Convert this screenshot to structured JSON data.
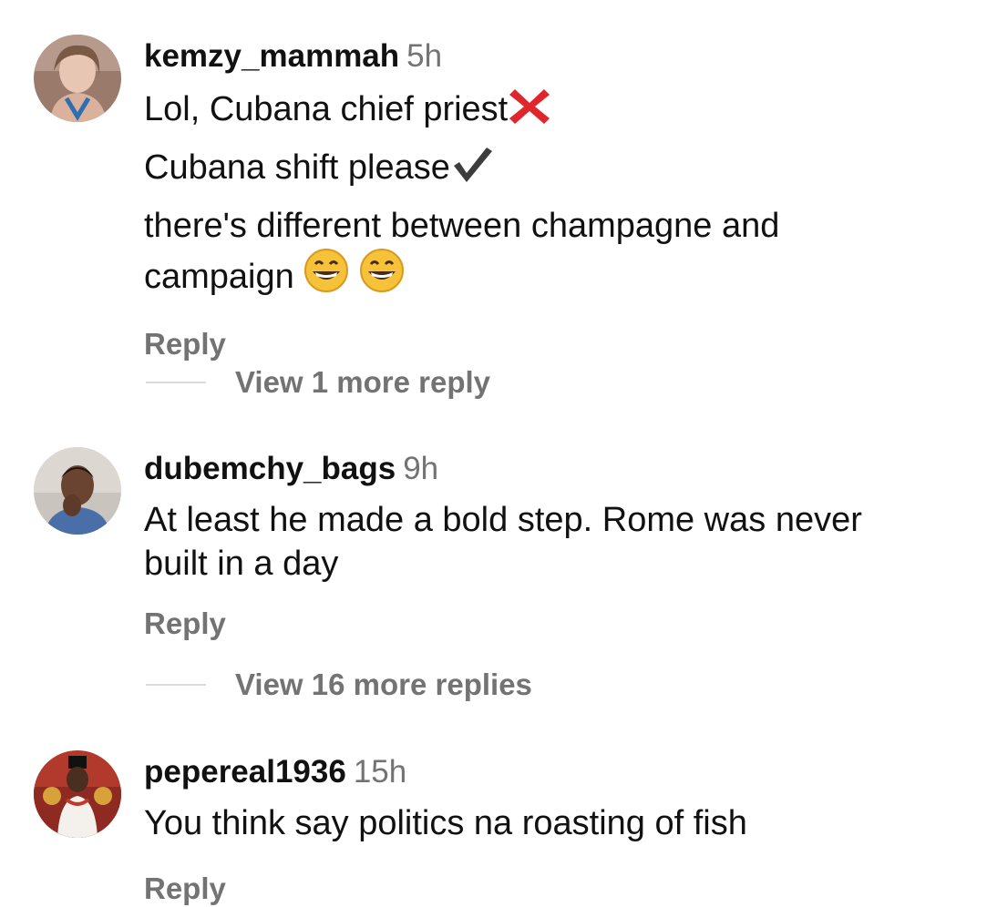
{
  "comments": [
    {
      "username": "kemzy_mammah",
      "time": "5h",
      "lines": [
        "Lol, Cubana chief priest",
        "Cubana shift please",
        " there's different between champagne and",
        "campaign "
      ],
      "icons": [
        "cross-mark-icon",
        "check-mark-icon",
        "grinning-face-emoji",
        "grinning-face-emoji"
      ],
      "reply_label": "Reply",
      "view_more_label": "View 1 more reply"
    },
    {
      "username": "dubemchy_bags",
      "time": "9h",
      "lines": [
        "At least he made  a bold step. Rome was never",
        "built in a day"
      ],
      "reply_label": "Reply",
      "view_more_label": "View 16 more replies"
    },
    {
      "username": "pepereal1936",
      "time": "15h",
      "lines": [
        "You think say politics na roasting of fish"
      ],
      "reply_label": "Reply"
    }
  ],
  "colors": {
    "text": "#111111",
    "secondary": "#737373",
    "divider": "#dbdbdb",
    "cross": "#e0262d",
    "emoji": "#f6c23a"
  }
}
